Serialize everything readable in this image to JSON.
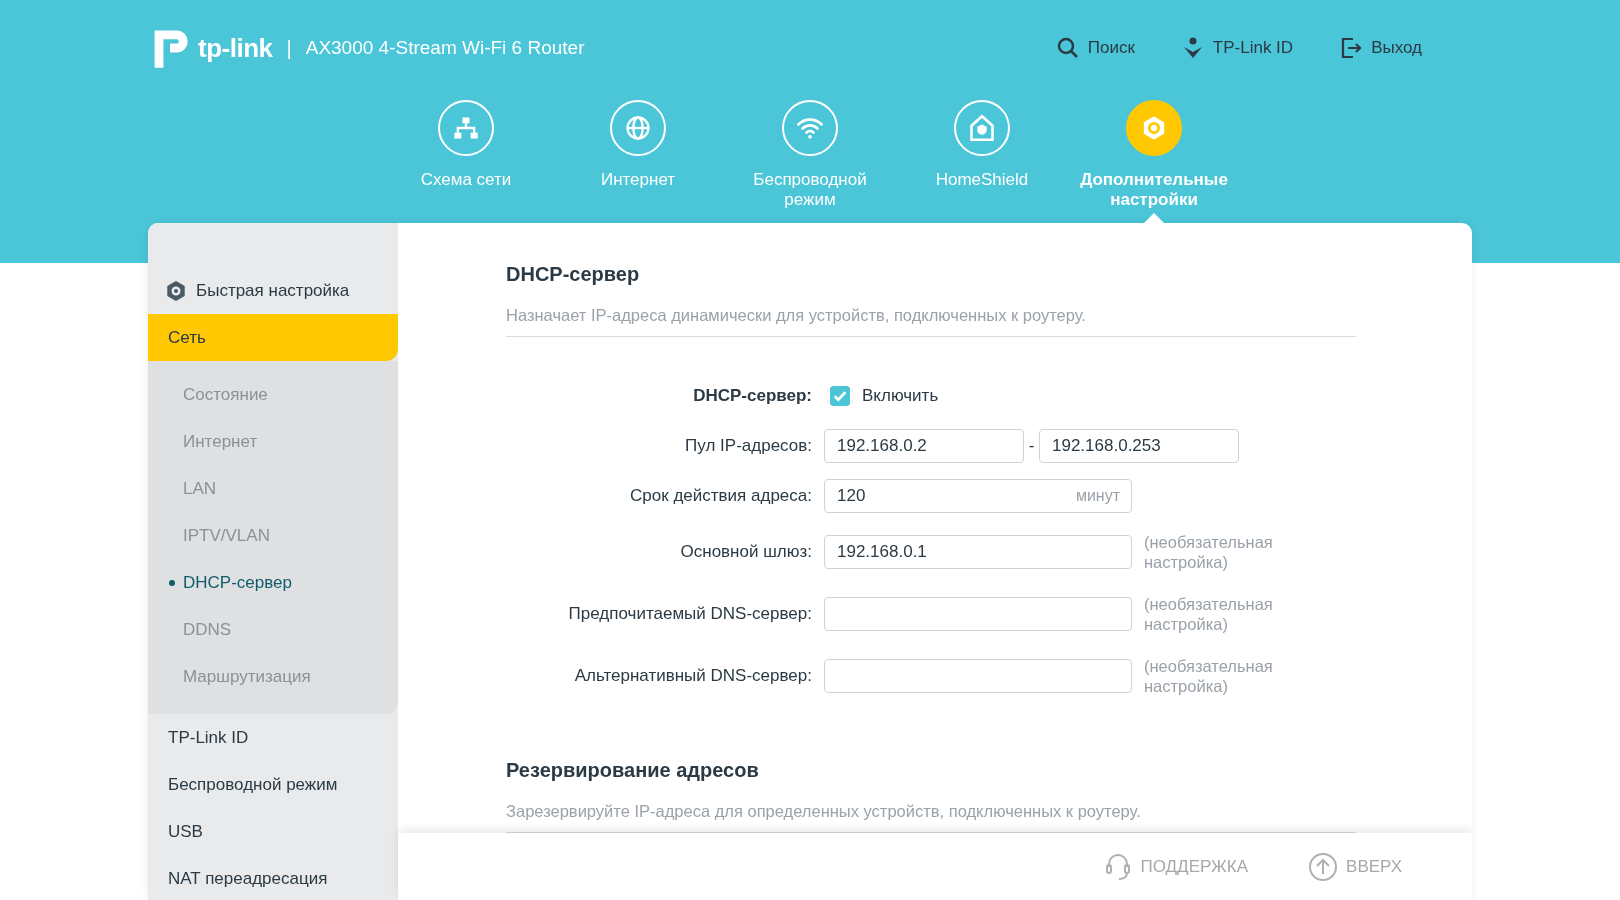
{
  "header": {
    "logo": "tp-link",
    "separator": "|",
    "model": "AX3000 4-Stream Wi-Fi 6 Router",
    "links": [
      {
        "kind": "search",
        "label": "Поиск"
      },
      {
        "kind": "id",
        "label": "TP-Link ID"
      },
      {
        "kind": "logout",
        "label": "Выход"
      }
    ]
  },
  "nav": [
    {
      "kind": "network",
      "label": "Схема сети",
      "selected": false
    },
    {
      "kind": "internet",
      "label": "Интернет",
      "selected": false
    },
    {
      "kind": "wireless",
      "label": "Беспроводной режим",
      "selected": false
    },
    {
      "kind": "shield",
      "label": "HomeShield",
      "selected": false
    },
    {
      "kind": "advanced",
      "label": "Дополнительные настройки",
      "selected": true
    }
  ],
  "sidebar": {
    "items": [
      {
        "kind": "quick",
        "label": "Быстрая настройка",
        "selected": false
      },
      {
        "kind": "plain",
        "label": "Сеть",
        "selected": true,
        "expanded": true,
        "children": [
          {
            "label": "Состояние",
            "selected": false
          },
          {
            "label": "Интернет",
            "selected": false
          },
          {
            "label": "LAN",
            "selected": false
          },
          {
            "label": "IPTV/VLAN",
            "selected": false
          },
          {
            "label": "DHCP-сервер",
            "selected": true
          },
          {
            "label": "DDNS",
            "selected": false
          },
          {
            "label": "Маршрутизация",
            "selected": false
          }
        ]
      },
      {
        "kind": "plain",
        "label": "TP-Link ID",
        "selected": false
      },
      {
        "kind": "plain",
        "label": "Беспроводной режим",
        "selected": false
      },
      {
        "kind": "plain",
        "label": "USB",
        "selected": false
      },
      {
        "kind": "plain",
        "label": "NAT переадресация",
        "selected": false
      }
    ]
  },
  "sections": [
    {
      "title": "DHCP-сервер",
      "description": "Назначает IP-адреса динамически для устройств, подключенных к роутеру.",
      "rows": [
        {
          "kind": "checkbox",
          "label": "DHCP-сервер:",
          "checked": true,
          "option": "Включить"
        },
        {
          "kind": "range",
          "label": "Пул IP-адресов:",
          "from": "192.168.0.2",
          "dash": "-",
          "to": "192.168.0.253"
        },
        {
          "kind": "unit",
          "label": "Срок действия адреса:",
          "value": "120",
          "unit": "минут"
        },
        {
          "kind": "text",
          "label": "Основной шлюз:",
          "value": "192.168.0.1",
          "note": "(необязательная настройка)"
        },
        {
          "kind": "text",
          "label": "Предпочитаемый DNS-сервер:",
          "value": "",
          "note": "(необязательная настройка)"
        },
        {
          "kind": "text",
          "label": "Альтернативный DNS-сервер:",
          "value": "",
          "note": "(необязательная настройка)"
        }
      ]
    },
    {
      "title": "Резервирование адресов",
      "description": "Зарезервируйте IP-адреса для определенных устройств, подключенных к роутеру."
    }
  ],
  "footer": [
    {
      "kind": "support",
      "label": "ПОДДЕРЖКА"
    },
    {
      "kind": "up",
      "label": "ВВЕРХ"
    }
  ]
}
